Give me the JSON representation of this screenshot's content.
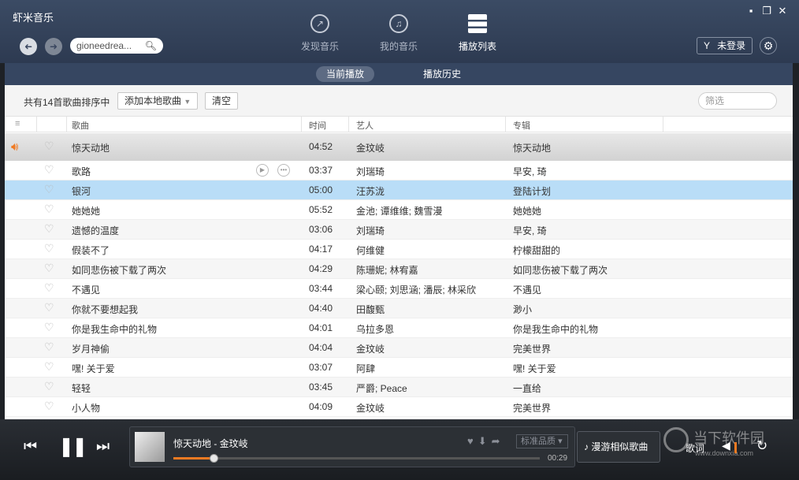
{
  "app": {
    "title": "虾米音乐"
  },
  "window": {
    "min": "▪",
    "max": "❐",
    "close": "✕"
  },
  "header": {
    "back": "➜",
    "forward": "➜",
    "search_value": "gioneedrea...",
    "search_icon": "search-icon",
    "nav": [
      {
        "label": "发现音乐",
        "icon": "compass-icon"
      },
      {
        "label": "我的音乐",
        "icon": "music-note-icon"
      },
      {
        "label": "播放列表",
        "icon": "playlist-icon",
        "active": true
      }
    ],
    "login_label": "未登录",
    "login_glyph": "Y",
    "settings_glyph": "⚙"
  },
  "subtabs": [
    {
      "label": "当前播放",
      "active": true
    },
    {
      "label": "播放历史",
      "active": false
    }
  ],
  "toolbar": {
    "count_text": "共有14首歌曲排序中",
    "add_local": "添加本地歌曲",
    "clear": "清空",
    "filter_placeholder": "筛选"
  },
  "columns": {
    "handle": "≡",
    "song": "歌曲",
    "time": "时间",
    "artist": "艺人",
    "album": "专辑"
  },
  "songs": [
    {
      "title": "惊天动地",
      "time": "04:52",
      "artist": "金玟岐",
      "album": "惊天动地",
      "playing": true
    },
    {
      "title": "歌路",
      "time": "03:37",
      "artist": "刘瑞琦",
      "album": "早安, 琦"
    },
    {
      "title": "银河",
      "time": "05:00",
      "artist": "汪苏泷",
      "album": "登陆计划",
      "selected": true
    },
    {
      "title": "她她她",
      "time": "05:52",
      "artist": "金池; 谭维维; 魏雪漫",
      "album": "她她她"
    },
    {
      "title": "遗憾的温度",
      "time": "03:06",
      "artist": "刘瑞琦",
      "album": "早安, 琦"
    },
    {
      "title": "假装不了",
      "time": "04:17",
      "artist": "何维健",
      "album": "柠檬甜甜的"
    },
    {
      "title": "如同悲伤被下载了两次",
      "time": "04:29",
      "artist": "陈珊妮; 林宥嘉",
      "album": "如同悲伤被下载了两次"
    },
    {
      "title": "不遇见",
      "time": "03:44",
      "artist": "梁心颐; 刘思涵; 潘辰; 林采欣",
      "album": "不遇见"
    },
    {
      "title": "你就不要想起我",
      "time": "04:40",
      "artist": "田馥甄",
      "album": "渺小"
    },
    {
      "title": "你是我生命中的礼物",
      "time": "04:01",
      "artist": "乌拉多恩",
      "album": "你是我生命中的礼物"
    },
    {
      "title": "岁月神偷",
      "time": "04:04",
      "artist": "金玟岐",
      "album": "完美世界"
    },
    {
      "title": "嘿! 关于爱",
      "time": "03:07",
      "artist": "阿肆",
      "album": "嘿! 关于爱"
    },
    {
      "title": "轻轻",
      "time": "03:45",
      "artist": "严爵; Peace",
      "album": "一直给"
    },
    {
      "title": "小人物",
      "time": "04:09",
      "artist": "金玟岐",
      "album": "完美世界"
    }
  ],
  "row_actions": {
    "play": "▶",
    "more": "•••"
  },
  "player": {
    "prev": "⏮",
    "pause": "❚❚",
    "next": "⏭",
    "now_playing": "惊天动地 - 金玟岐",
    "elapsed": "00:29",
    "progress": 0.11,
    "quality": "标准品质",
    "quality_caret": "▾",
    "similar": "漫游相似歌曲",
    "lyric": "歌词",
    "volume_glyph": "◀",
    "loop_glyph": "↻",
    "action_icons": "♥⬇➦"
  },
  "watermark": {
    "cn": "当下软件园",
    "url": "www.downxia.com"
  },
  "colors": {
    "accent": "#f07a22",
    "selected": "#b9ddf7",
    "header": "#3b4b64"
  }
}
